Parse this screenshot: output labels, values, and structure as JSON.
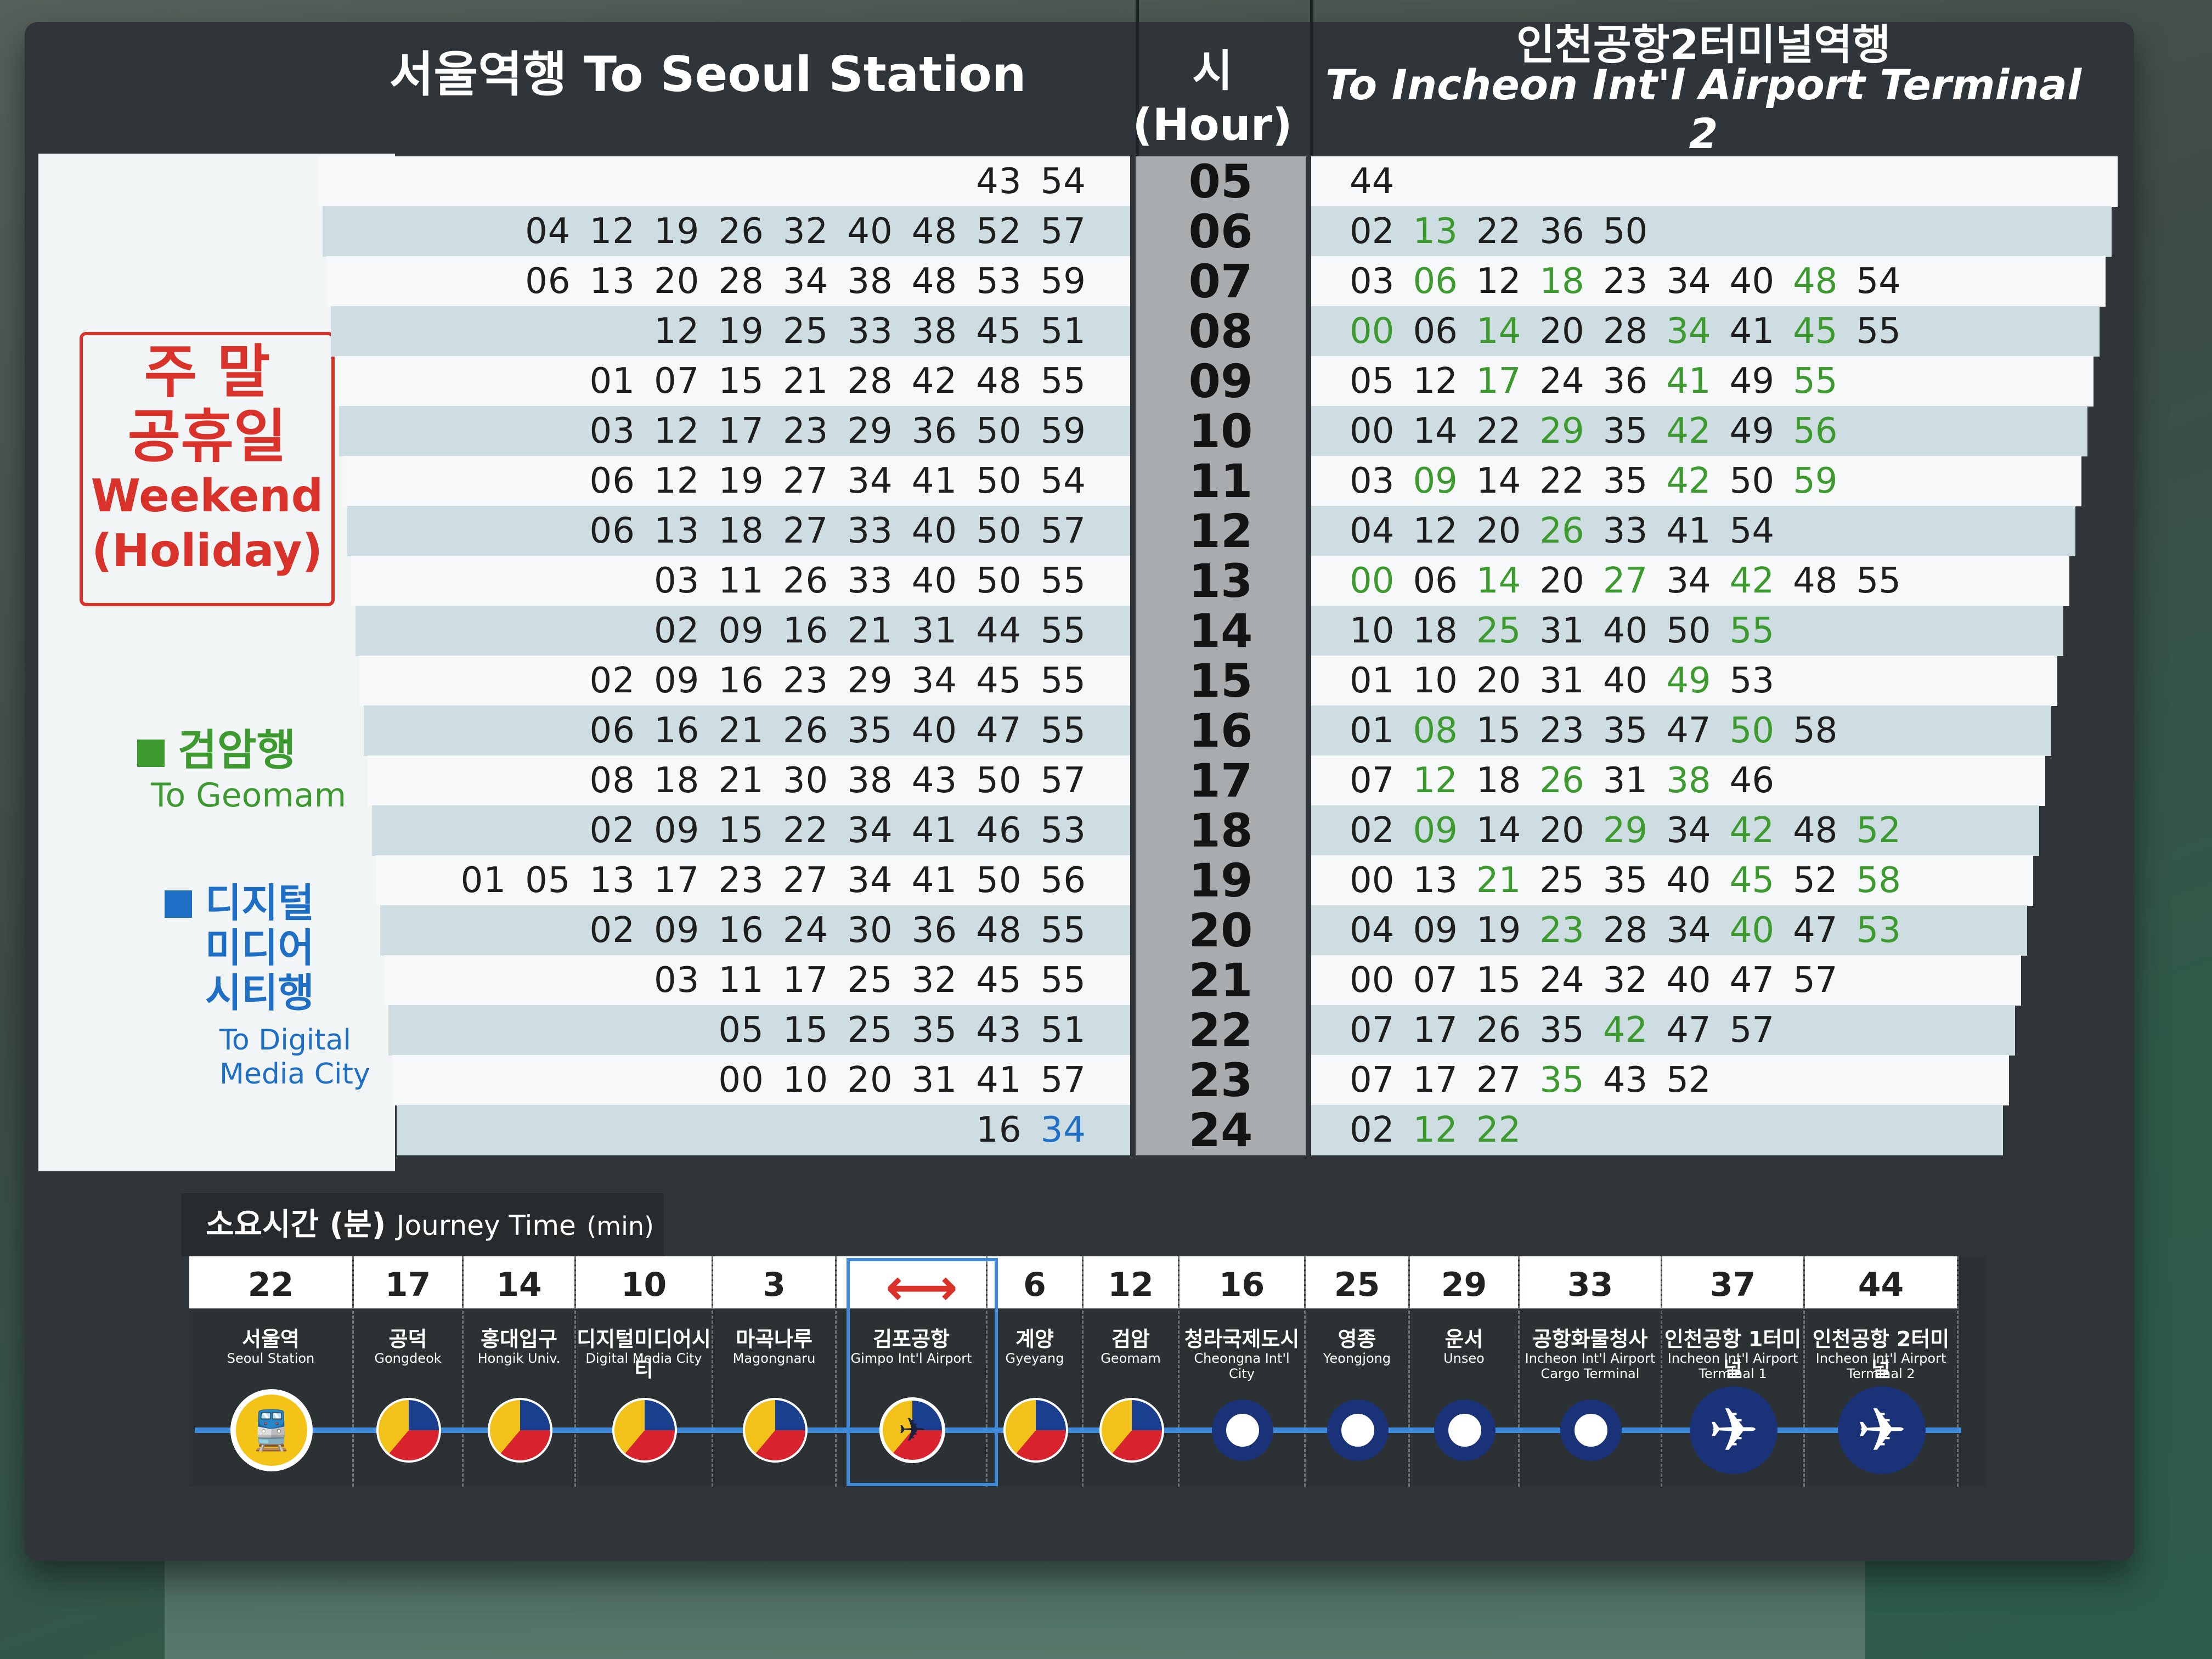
{
  "header": {
    "left_title": "서울역행 To Seoul Station",
    "hour_title": "시 (Hour)",
    "right_title_ko": "인천공항2터미널역행",
    "right_title_en": "To Incheon Int'l Airport Terminal 2"
  },
  "legend": {
    "weekend_ko_line1": "주  말",
    "weekend_ko_line2": "공휴일",
    "weekend_en_line1": "Weekend",
    "weekend_en_line2": "(Holiday)",
    "geomam_ko": "검암행",
    "geomam_en": "To Geomam",
    "dmc_ko_1": "디지털",
    "dmc_ko_2": "미디어",
    "dmc_ko_3": "시티행",
    "dmc_en_1": "To Digital",
    "dmc_en_2": "Media City",
    "colors": {
      "geomam": "#3d9a2f",
      "dmc": "#1f6fc6",
      "weekend": "#d8322a"
    }
  },
  "timetable": [
    {
      "hour": "05",
      "left": [
        [
          "43",
          ""
        ],
        [
          "54",
          ""
        ]
      ],
      "right": [
        [
          "44",
          ""
        ]
      ]
    },
    {
      "hour": "06",
      "left": [
        [
          "04",
          ""
        ],
        [
          "12",
          ""
        ],
        [
          "19",
          ""
        ],
        [
          "26",
          ""
        ],
        [
          "32",
          ""
        ],
        [
          "40",
          ""
        ],
        [
          "48",
          ""
        ],
        [
          "52",
          ""
        ],
        [
          "57",
          ""
        ]
      ],
      "right": [
        [
          "02",
          ""
        ],
        [
          "13",
          "g"
        ],
        [
          "22",
          ""
        ],
        [
          "36",
          ""
        ],
        [
          "50",
          ""
        ]
      ]
    },
    {
      "hour": "07",
      "left": [
        [
          "06",
          ""
        ],
        [
          "13",
          ""
        ],
        [
          "20",
          ""
        ],
        [
          "28",
          ""
        ],
        [
          "34",
          ""
        ],
        [
          "38",
          ""
        ],
        [
          "48",
          ""
        ],
        [
          "53",
          ""
        ],
        [
          "59",
          ""
        ]
      ],
      "right": [
        [
          "03",
          ""
        ],
        [
          "06",
          "g"
        ],
        [
          "12",
          ""
        ],
        [
          "18",
          "g"
        ],
        [
          "23",
          ""
        ],
        [
          "34",
          ""
        ],
        [
          "40",
          ""
        ],
        [
          "48",
          "g"
        ],
        [
          "54",
          ""
        ]
      ]
    },
    {
      "hour": "08",
      "left": [
        [
          "12",
          ""
        ],
        [
          "19",
          ""
        ],
        [
          "25",
          ""
        ],
        [
          "33",
          ""
        ],
        [
          "38",
          ""
        ],
        [
          "45",
          ""
        ],
        [
          "51",
          ""
        ]
      ],
      "right": [
        [
          "00",
          "g"
        ],
        [
          "06",
          ""
        ],
        [
          "14",
          "g"
        ],
        [
          "20",
          ""
        ],
        [
          "28",
          ""
        ],
        [
          "34",
          "g"
        ],
        [
          "41",
          ""
        ],
        [
          "45",
          "g"
        ],
        [
          "55",
          ""
        ]
      ]
    },
    {
      "hour": "09",
      "left": [
        [
          "01",
          ""
        ],
        [
          "07",
          ""
        ],
        [
          "15",
          ""
        ],
        [
          "21",
          ""
        ],
        [
          "28",
          ""
        ],
        [
          "42",
          ""
        ],
        [
          "48",
          ""
        ],
        [
          "55",
          ""
        ]
      ],
      "right": [
        [
          "05",
          ""
        ],
        [
          "12",
          ""
        ],
        [
          "17",
          "g"
        ],
        [
          "24",
          ""
        ],
        [
          "36",
          ""
        ],
        [
          "41",
          "g"
        ],
        [
          "49",
          ""
        ],
        [
          "55",
          "g"
        ]
      ]
    },
    {
      "hour": "10",
      "left": [
        [
          "03",
          ""
        ],
        [
          "12",
          ""
        ],
        [
          "17",
          ""
        ],
        [
          "23",
          ""
        ],
        [
          "29",
          ""
        ],
        [
          "36",
          ""
        ],
        [
          "50",
          ""
        ],
        [
          "59",
          ""
        ]
      ],
      "right": [
        [
          "00",
          ""
        ],
        [
          "14",
          ""
        ],
        [
          "22",
          ""
        ],
        [
          "29",
          "g"
        ],
        [
          "35",
          ""
        ],
        [
          "42",
          "g"
        ],
        [
          "49",
          ""
        ],
        [
          "56",
          "g"
        ]
      ]
    },
    {
      "hour": "11",
      "left": [
        [
          "06",
          ""
        ],
        [
          "12",
          ""
        ],
        [
          "19",
          ""
        ],
        [
          "27",
          ""
        ],
        [
          "34",
          ""
        ],
        [
          "41",
          ""
        ],
        [
          "50",
          ""
        ],
        [
          "54",
          ""
        ]
      ],
      "right": [
        [
          "03",
          ""
        ],
        [
          "09",
          "g"
        ],
        [
          "14",
          ""
        ],
        [
          "22",
          ""
        ],
        [
          "35",
          ""
        ],
        [
          "42",
          "g"
        ],
        [
          "50",
          ""
        ],
        [
          "59",
          "g"
        ]
      ]
    },
    {
      "hour": "12",
      "left": [
        [
          "06",
          ""
        ],
        [
          "13",
          ""
        ],
        [
          "18",
          ""
        ],
        [
          "27",
          ""
        ],
        [
          "33",
          ""
        ],
        [
          "40",
          ""
        ],
        [
          "50",
          ""
        ],
        [
          "57",
          ""
        ]
      ],
      "right": [
        [
          "04",
          ""
        ],
        [
          "12",
          ""
        ],
        [
          "20",
          ""
        ],
        [
          "26",
          "g"
        ],
        [
          "33",
          ""
        ],
        [
          "41",
          ""
        ],
        [
          "54",
          ""
        ]
      ]
    },
    {
      "hour": "13",
      "left": [
        [
          "03",
          ""
        ],
        [
          "11",
          ""
        ],
        [
          "26",
          ""
        ],
        [
          "33",
          ""
        ],
        [
          "40",
          ""
        ],
        [
          "50",
          ""
        ],
        [
          "55",
          ""
        ]
      ],
      "right": [
        [
          "00",
          "g"
        ],
        [
          "06",
          ""
        ],
        [
          "14",
          "g"
        ],
        [
          "20",
          ""
        ],
        [
          "27",
          "g"
        ],
        [
          "34",
          ""
        ],
        [
          "42",
          "g"
        ],
        [
          "48",
          ""
        ],
        [
          "55",
          ""
        ]
      ]
    },
    {
      "hour": "14",
      "left": [
        [
          "02",
          ""
        ],
        [
          "09",
          ""
        ],
        [
          "16",
          ""
        ],
        [
          "21",
          ""
        ],
        [
          "31",
          ""
        ],
        [
          "44",
          ""
        ],
        [
          "55",
          ""
        ]
      ],
      "right": [
        [
          "10",
          ""
        ],
        [
          "18",
          ""
        ],
        [
          "25",
          "g"
        ],
        [
          "31",
          ""
        ],
        [
          "40",
          ""
        ],
        [
          "50",
          ""
        ],
        [
          "55",
          "g"
        ]
      ]
    },
    {
      "hour": "15",
      "left": [
        [
          "02",
          ""
        ],
        [
          "09",
          ""
        ],
        [
          "16",
          ""
        ],
        [
          "23",
          ""
        ],
        [
          "29",
          ""
        ],
        [
          "34",
          ""
        ],
        [
          "45",
          ""
        ],
        [
          "55",
          ""
        ]
      ],
      "right": [
        [
          "01",
          ""
        ],
        [
          "10",
          ""
        ],
        [
          "20",
          ""
        ],
        [
          "31",
          ""
        ],
        [
          "40",
          ""
        ],
        [
          "49",
          "g"
        ],
        [
          "53",
          ""
        ]
      ]
    },
    {
      "hour": "16",
      "left": [
        [
          "06",
          ""
        ],
        [
          "16",
          ""
        ],
        [
          "21",
          ""
        ],
        [
          "26",
          ""
        ],
        [
          "35",
          ""
        ],
        [
          "40",
          ""
        ],
        [
          "47",
          ""
        ],
        [
          "55",
          ""
        ]
      ],
      "right": [
        [
          "01",
          ""
        ],
        [
          "08",
          "g"
        ],
        [
          "15",
          ""
        ],
        [
          "23",
          ""
        ],
        [
          "35",
          ""
        ],
        [
          "47",
          ""
        ],
        [
          "50",
          "g"
        ],
        [
          "58",
          ""
        ]
      ]
    },
    {
      "hour": "17",
      "left": [
        [
          "08",
          ""
        ],
        [
          "18",
          ""
        ],
        [
          "21",
          ""
        ],
        [
          "30",
          ""
        ],
        [
          "38",
          ""
        ],
        [
          "43",
          ""
        ],
        [
          "50",
          ""
        ],
        [
          "57",
          ""
        ]
      ],
      "right": [
        [
          "07",
          ""
        ],
        [
          "12",
          "g"
        ],
        [
          "18",
          ""
        ],
        [
          "26",
          "g"
        ],
        [
          "31",
          ""
        ],
        [
          "38",
          "g"
        ],
        [
          "46",
          ""
        ]
      ]
    },
    {
      "hour": "18",
      "left": [
        [
          "02",
          ""
        ],
        [
          "09",
          ""
        ],
        [
          "15",
          ""
        ],
        [
          "22",
          ""
        ],
        [
          "34",
          ""
        ],
        [
          "41",
          ""
        ],
        [
          "46",
          ""
        ],
        [
          "53",
          ""
        ]
      ],
      "right": [
        [
          "02",
          ""
        ],
        [
          "09",
          "g"
        ],
        [
          "14",
          ""
        ],
        [
          "20",
          ""
        ],
        [
          "29",
          "g"
        ],
        [
          "34",
          ""
        ],
        [
          "42",
          "g"
        ],
        [
          "48",
          ""
        ],
        [
          "52",
          "g"
        ]
      ]
    },
    {
      "hour": "19",
      "left": [
        [
          "01",
          ""
        ],
        [
          "05",
          ""
        ],
        [
          "13",
          ""
        ],
        [
          "17",
          ""
        ],
        [
          "23",
          ""
        ],
        [
          "27",
          ""
        ],
        [
          "34",
          ""
        ],
        [
          "41",
          ""
        ],
        [
          "50",
          ""
        ],
        [
          "56",
          ""
        ]
      ],
      "right": [
        [
          "00",
          ""
        ],
        [
          "13",
          ""
        ],
        [
          "21",
          "g"
        ],
        [
          "25",
          ""
        ],
        [
          "35",
          ""
        ],
        [
          "40",
          ""
        ],
        [
          "45",
          "g"
        ],
        [
          "52",
          ""
        ],
        [
          "58",
          "g"
        ]
      ]
    },
    {
      "hour": "20",
      "left": [
        [
          "02",
          ""
        ],
        [
          "09",
          ""
        ],
        [
          "16",
          ""
        ],
        [
          "24",
          ""
        ],
        [
          "30",
          ""
        ],
        [
          "36",
          ""
        ],
        [
          "48",
          ""
        ],
        [
          "55",
          ""
        ]
      ],
      "right": [
        [
          "04",
          ""
        ],
        [
          "09",
          ""
        ],
        [
          "19",
          ""
        ],
        [
          "23",
          "g"
        ],
        [
          "28",
          ""
        ],
        [
          "34",
          ""
        ],
        [
          "40",
          "g"
        ],
        [
          "47",
          ""
        ],
        [
          "53",
          "g"
        ]
      ]
    },
    {
      "hour": "21",
      "left": [
        [
          "03",
          ""
        ],
        [
          "11",
          ""
        ],
        [
          "17",
          ""
        ],
        [
          "25",
          ""
        ],
        [
          "32",
          ""
        ],
        [
          "45",
          ""
        ],
        [
          "55",
          ""
        ]
      ],
      "right": [
        [
          "00",
          ""
        ],
        [
          "07",
          ""
        ],
        [
          "15",
          ""
        ],
        [
          "24",
          ""
        ],
        [
          "32",
          ""
        ],
        [
          "40",
          ""
        ],
        [
          "47",
          ""
        ],
        [
          "57",
          ""
        ]
      ]
    },
    {
      "hour": "22",
      "left": [
        [
          "05",
          ""
        ],
        [
          "15",
          ""
        ],
        [
          "25",
          ""
        ],
        [
          "35",
          ""
        ],
        [
          "43",
          ""
        ],
        [
          "51",
          ""
        ]
      ],
      "right": [
        [
          "07",
          ""
        ],
        [
          "17",
          ""
        ],
        [
          "26",
          ""
        ],
        [
          "35",
          ""
        ],
        [
          "42",
          "g"
        ],
        [
          "47",
          ""
        ],
        [
          "57",
          ""
        ]
      ]
    },
    {
      "hour": "23",
      "left": [
        [
          "00",
          ""
        ],
        [
          "10",
          ""
        ],
        [
          "20",
          ""
        ],
        [
          "31",
          ""
        ],
        [
          "41",
          ""
        ],
        [
          "57",
          ""
        ]
      ],
      "right": [
        [
          "07",
          ""
        ],
        [
          "17",
          ""
        ],
        [
          "27",
          ""
        ],
        [
          "35",
          "g"
        ],
        [
          "43",
          ""
        ],
        [
          "52",
          ""
        ]
      ]
    },
    {
      "hour": "24",
      "left": [
        [
          "16",
          ""
        ],
        [
          "34",
          "b"
        ]
      ],
      "right": [
        [
          "02",
          ""
        ],
        [
          "12",
          "g"
        ],
        [
          "22",
          "g"
        ]
      ]
    }
  ],
  "journey": {
    "title_ko": "소요시간 (분)",
    "title_en": "Journey Time",
    "title_unit": "(min)",
    "stations": [
      {
        "min": "22",
        "ko": "서울역",
        "en": "Seoul Station",
        "en2": "",
        "icon": "seoul"
      },
      {
        "min": "17",
        "ko": "공덕",
        "en": "Gongdeok",
        "en2": "",
        "icon": "taeguk"
      },
      {
        "min": "14",
        "ko": "홍대입구",
        "en": "Hongik Univ.",
        "en2": "",
        "icon": "taeguk"
      },
      {
        "min": "10",
        "ko": "디지털미디어시티",
        "en": "Digital Media City",
        "en2": "",
        "icon": "taeguk"
      },
      {
        "min": "3",
        "ko": "마곡나루",
        "en": "Magongnaru",
        "en2": "",
        "icon": "taeguk"
      },
      {
        "min": "",
        "ko": "김포공항",
        "en": "Gimpo Int'l Airport",
        "en2": "",
        "icon": "gimpo"
      },
      {
        "min": "6",
        "ko": "계양",
        "en": "Gyeyang",
        "en2": "",
        "icon": "taeguk"
      },
      {
        "min": "12",
        "ko": "검암",
        "en": "Geomam",
        "en2": "",
        "icon": "taeguk"
      },
      {
        "min": "16",
        "ko": "청라국제도시",
        "en": "Cheongna Int'l City",
        "en2": "",
        "icon": "plain"
      },
      {
        "min": "25",
        "ko": "영종",
        "en": "Yeongjong",
        "en2": "",
        "icon": "plain"
      },
      {
        "min": "29",
        "ko": "운서",
        "en": "Unseo",
        "en2": "",
        "icon": "plain"
      },
      {
        "min": "33",
        "ko": "공항화물청사",
        "en": "Incheon Int'l Airport",
        "en2": "Cargo Terminal",
        "icon": "plain"
      },
      {
        "min": "37",
        "ko": "인천공항 1터미널",
        "en": "Incheon Int'l Airport",
        "en2": "Terminal 1",
        "icon": "plane"
      },
      {
        "min": "44",
        "ko": "인천공항 2터미널",
        "en": "Incheon Int'l Airport",
        "en2": "Terminal 2",
        "icon": "plane"
      }
    ]
  }
}
